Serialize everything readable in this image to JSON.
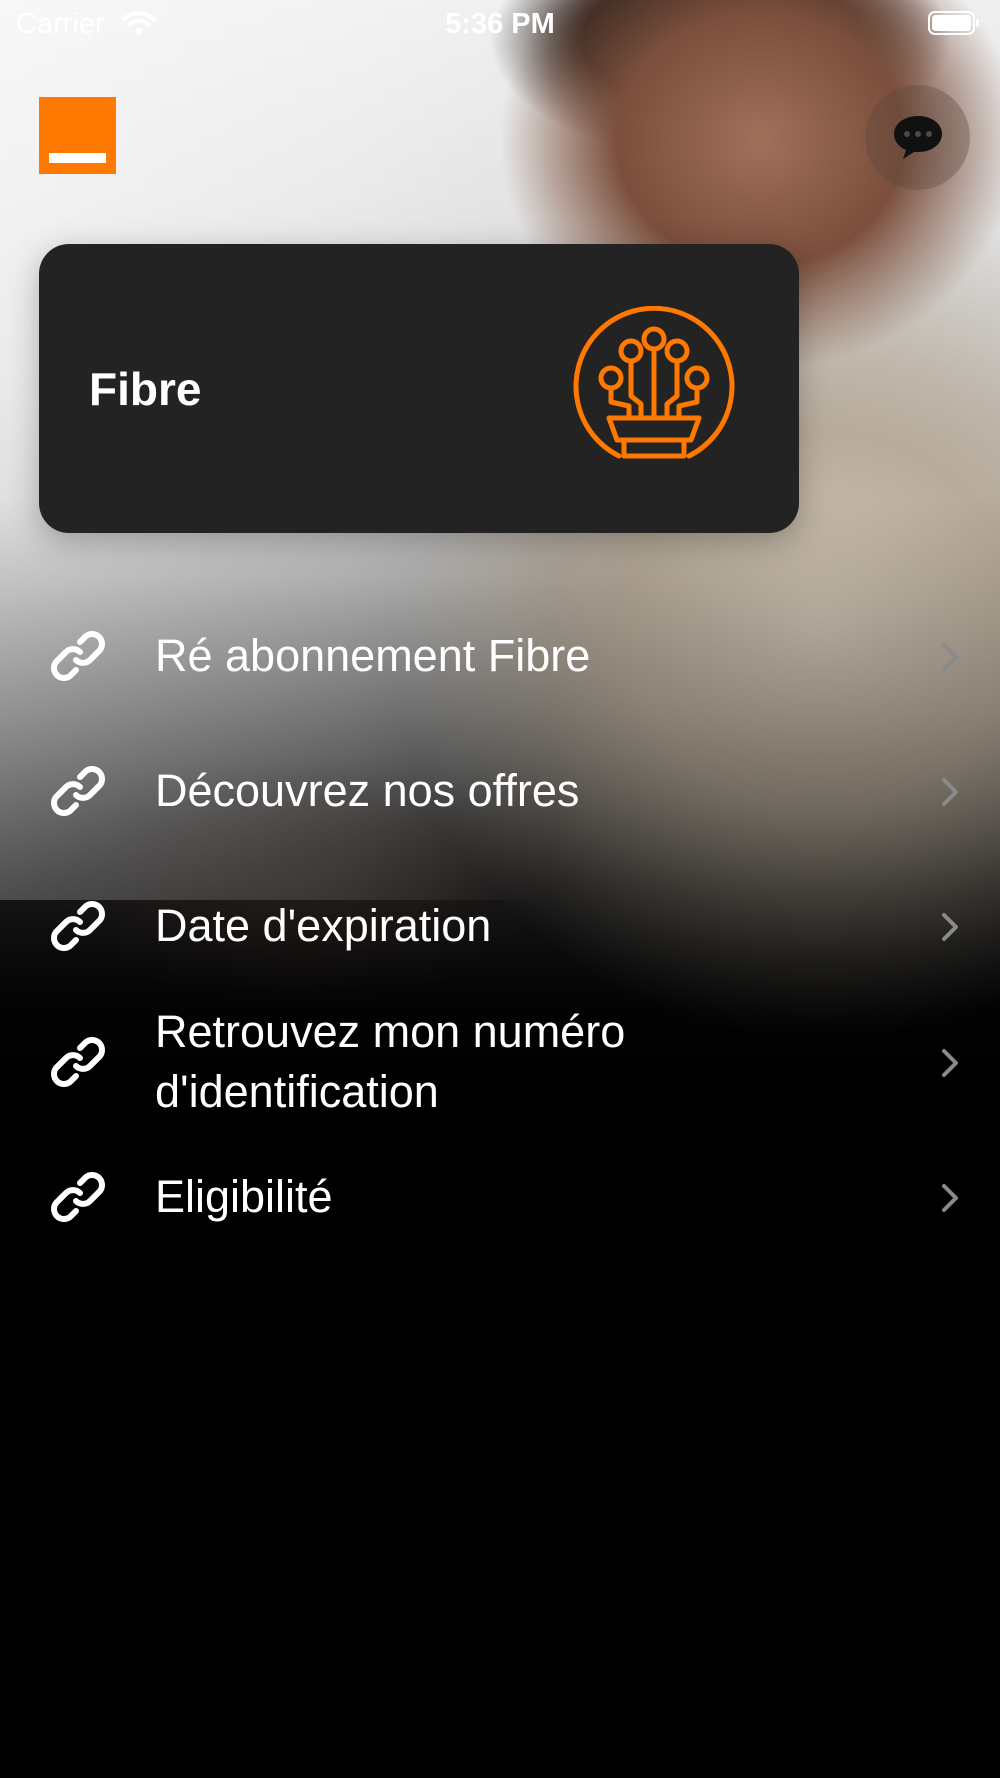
{
  "status_bar": {
    "carrier": "Carrier",
    "time": "5:36 PM"
  },
  "header": {
    "logo_icon": "orange-logo",
    "chat_icon": "chat-bubble-icon"
  },
  "card": {
    "title": "Fibre",
    "icon": "fiber-optic-icon",
    "accent_color": "#ff7900",
    "background_color": "#232323"
  },
  "menu": {
    "items": [
      {
        "label": "Ré abonnement Fibre",
        "icon": "link-icon"
      },
      {
        "label": "Découvrez nos offres",
        "icon": "link-icon"
      },
      {
        "label": "Date d'expiration",
        "icon": "link-icon"
      },
      {
        "label": "Retrouvez mon numéro d'identification",
        "icon": "link-icon"
      },
      {
        "label": "Eligibilité",
        "icon": "link-icon"
      }
    ]
  },
  "colors": {
    "brand_orange": "#ff7900",
    "text": "#ffffff",
    "chevron": "#8a8a8a"
  }
}
